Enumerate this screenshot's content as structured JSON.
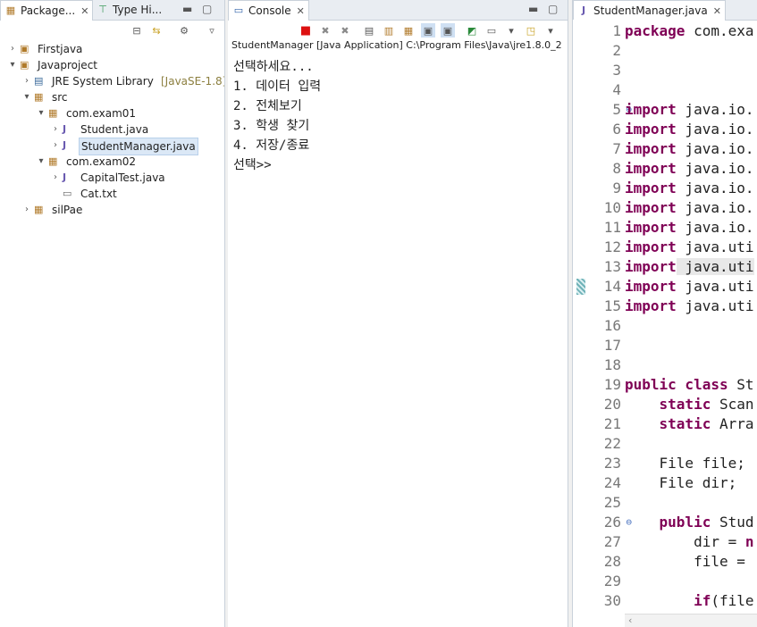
{
  "package_explorer": {
    "tabs": [
      {
        "label": "Package..."
      },
      {
        "label": "Type Hi..."
      }
    ],
    "tree": [
      {
        "label": "Firstjava",
        "depth": 0,
        "expanded": false,
        "icon": "project-icon"
      },
      {
        "label": "Javaproject",
        "depth": 0,
        "expanded": true,
        "icon": "project-icon"
      },
      {
        "label": "JRE System Library",
        "decoration": "[JavaSE-1.8]",
        "depth": 1,
        "expanded": false,
        "icon": "library-icon"
      },
      {
        "label": "src",
        "depth": 1,
        "expanded": true,
        "icon": "source-folder-icon"
      },
      {
        "label": "com.exam01",
        "depth": 2,
        "expanded": true,
        "icon": "package-icon"
      },
      {
        "label": "Student.java",
        "depth": 3,
        "expanded": false,
        "icon": "java-file-icon"
      },
      {
        "label": "StudentManager.java",
        "depth": 3,
        "expanded": false,
        "icon": "java-file-icon",
        "selected": true
      },
      {
        "label": "com.exam02",
        "depth": 2,
        "expanded": true,
        "icon": "package-icon"
      },
      {
        "label": "CapitalTest.java",
        "depth": 3,
        "expanded": false,
        "icon": "java-file-icon"
      },
      {
        "label": "Cat.txt",
        "depth": 3,
        "leaf": true,
        "icon": "text-file-icon"
      },
      {
        "label": "silPae",
        "depth": 1,
        "expanded": false,
        "icon": "package-icon"
      }
    ]
  },
  "console": {
    "tab_label": "Console",
    "launch_label": "StudentManager [Java Application] C:\\Program Files\\Java\\jre1.8.0_2",
    "output": [
      "선택하세요...",
      "1. 데이터 입력",
      "2. 전체보기",
      "3. 학생 찾기",
      "4. 저장/종료",
      "선택>>"
    ]
  },
  "editor": {
    "tab_label": "StudentManager.java",
    "lines": [
      {
        "n": "1",
        "kw": "package",
        "rest": " com.exa"
      },
      {
        "n": "2",
        "kw": "",
        "rest": ""
      },
      {
        "n": "3",
        "kw": "",
        "rest": ""
      },
      {
        "n": "4",
        "kw": "",
        "rest": ""
      },
      {
        "n": "5",
        "kw": "import",
        "rest": " java.io.",
        "fold": true
      },
      {
        "n": "6",
        "kw": "import",
        "rest": " java.io."
      },
      {
        "n": "7",
        "kw": "import",
        "rest": " java.io."
      },
      {
        "n": "8",
        "kw": "import",
        "rest": " java.io."
      },
      {
        "n": "9",
        "kw": "import",
        "rest": " java.io."
      },
      {
        "n": "10",
        "kw": "import",
        "rest": " java.io."
      },
      {
        "n": "11",
        "kw": "import",
        "rest": " java.io."
      },
      {
        "n": "12",
        "kw": "import",
        "rest": " java.uti"
      },
      {
        "n": "13",
        "kw": "import",
        "rest": " java.uti",
        "highlight": true
      },
      {
        "n": "14",
        "kw": "import",
        "rest": " java.uti"
      },
      {
        "n": "15",
        "kw": "import",
        "rest": " java.uti"
      },
      {
        "n": "16",
        "kw": "",
        "rest": ""
      },
      {
        "n": "17",
        "kw": "",
        "rest": ""
      },
      {
        "n": "18",
        "kw": "",
        "rest": ""
      },
      {
        "n": "19",
        "kw": "public class",
        "rest": " St"
      },
      {
        "n": "20",
        "kw": "    static",
        "rest": " Scan"
      },
      {
        "n": "21",
        "kw": "    static",
        "rest": " Arra"
      },
      {
        "n": "22",
        "kw": "",
        "rest": ""
      },
      {
        "n": "23",
        "kw": "",
        "rest": "    File file;"
      },
      {
        "n": "24",
        "kw": "",
        "rest": "    File dir;"
      },
      {
        "n": "25",
        "kw": "",
        "rest": ""
      },
      {
        "n": "26",
        "kw": "    public",
        "rest": " Stud",
        "fold": true
      },
      {
        "n": "27",
        "kw": "",
        "rest": "        dir = ",
        "kw2": "n"
      },
      {
        "n": "28",
        "kw": "",
        "rest": "        file = "
      },
      {
        "n": "29",
        "kw": "",
        "rest": ""
      },
      {
        "n": "30",
        "kw": "        if",
        "rest": "(file"
      }
    ]
  }
}
